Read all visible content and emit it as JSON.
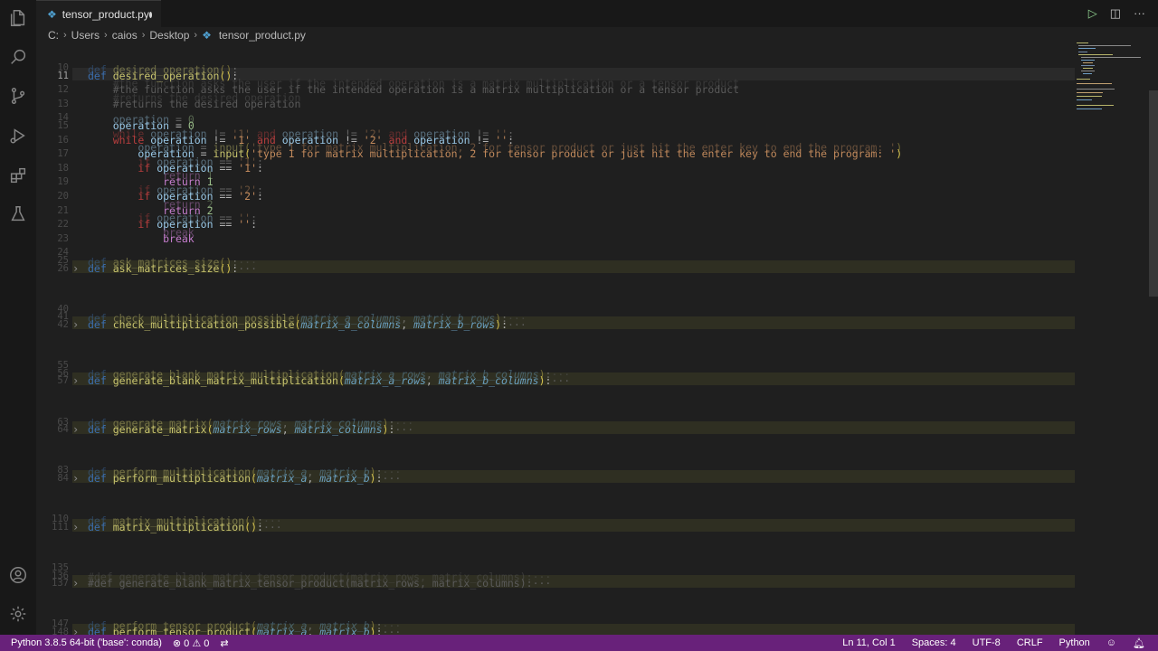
{
  "tab": {
    "name": "tensor_product.py",
    "icon": "python-file-icon"
  },
  "breadcrumb": [
    "C:",
    "Users",
    "caios",
    "Desktop",
    "tensor_product.py"
  ],
  "status": {
    "interpreter": "Python 3.8.5 64-bit ('base': conda)",
    "errors": "0",
    "warnings": "0",
    "position": "Ln 11, Col 1",
    "spaces": "Spaces: 4",
    "encoding": "UTF-8",
    "eol": "CRLF",
    "language": "Python"
  },
  "code": [
    {
      "n": "10",
      "t": ""
    },
    {
      "n": "11",
      "t": "def desired_operation():",
      "cur": true
    },
    {
      "n": "12",
      "t": "    #the function asks the user if the intended operation is a matrix multiplication or a tensor product"
    },
    {
      "n": "13",
      "t": "    #returns the desired operation"
    },
    {
      "n": "14",
      "t": ""
    },
    {
      "n": "15",
      "t": "    operation = 0"
    },
    {
      "n": "16",
      "t": "    while operation != '1' and operation != '2' and operation != '':"
    },
    {
      "n": "17",
      "t": "        operation = input('type 1 for matrix multiplication, 2 for tensor product or just hit the enter key to end the program: ')"
    },
    {
      "n": "18",
      "t": "        if operation == '1':"
    },
    {
      "n": "19",
      "t": "            return 1"
    },
    {
      "n": "20",
      "t": "        if operation == '2':"
    },
    {
      "n": "21",
      "t": "            return 2"
    },
    {
      "n": "22",
      "t": "        if operation == '':"
    },
    {
      "n": "23",
      "t": "            break"
    },
    {
      "n": "24",
      "t": ""
    },
    {
      "n": "25",
      "t": ""
    },
    {
      "n": "26",
      "t": "def ask_matrices_size():···",
      "fold": true
    },
    {
      "n": "40",
      "t": ""
    },
    {
      "n": "41",
      "t": ""
    },
    {
      "n": "42",
      "t": "def check_multiplication_possible(matrix_a_columns, matrix_b_rows):···",
      "fold": true
    },
    {
      "n": "55",
      "t": ""
    },
    {
      "n": "56",
      "t": ""
    },
    {
      "n": "57",
      "t": "def generate_blank_matrix_multiplication(matrix_a_rows, matrix_b_columns):···",
      "fold": true
    },
    {
      "n": "63",
      "t": ""
    },
    {
      "n": "64",
      "t": "def generate_matrix(matrix_rows, matrix_columns):···",
      "fold": true
    },
    {
      "n": "83",
      "t": ""
    },
    {
      "n": "84",
      "t": "def perform_multiplication(matrix_a, matrix_b):···",
      "fold": true
    },
    {
      "n": "110",
      "t": ""
    },
    {
      "n": "111",
      "t": "def matrix_multiplication():···",
      "fold": true
    },
    {
      "n": "135",
      "t": ""
    },
    {
      "n": "136",
      "t": ""
    },
    {
      "n": "137",
      "t": "#def generate_blank_matrix_tensor_product(matrix_rows, matrix_columns):···",
      "fold": true
    },
    {
      "n": "147",
      "t": ""
    },
    {
      "n": "148",
      "t": "def perform_tensor_product(matrix_a, matrix_b):···",
      "fold": true
    },
    {
      "n": "22",
      "t": ""
    }
  ]
}
